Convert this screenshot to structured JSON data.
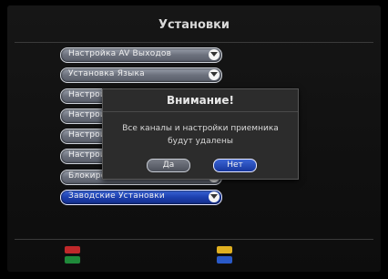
{
  "header": {
    "title": "Установки"
  },
  "menu": {
    "items": [
      {
        "label": "Настройка AV Выходов"
      },
      {
        "label": "Установка Языка"
      },
      {
        "label": "Настройка Антенны"
      },
      {
        "label": "Настрой"
      },
      {
        "label": "Настрой"
      },
      {
        "label": "Настрой"
      },
      {
        "label": "Блокиро"
      },
      {
        "label": "Заводские Установки",
        "selected": true
      }
    ]
  },
  "dialog": {
    "title": "Внимание!",
    "message_line1": "Все каналы и настройки приемника",
    "message_line2": "будут удалены",
    "yes_label": "Да",
    "no_label": "Нет"
  },
  "color_keys": {
    "red": "#c0282a",
    "green": "#1f8a3a",
    "yellow": "#e0b020",
    "blue": "#2a5ac8"
  },
  "colors": {
    "selected_accent": "#1c3fae",
    "button_grey": "#6b707c",
    "dialog_bg": "#2c2c2c"
  }
}
